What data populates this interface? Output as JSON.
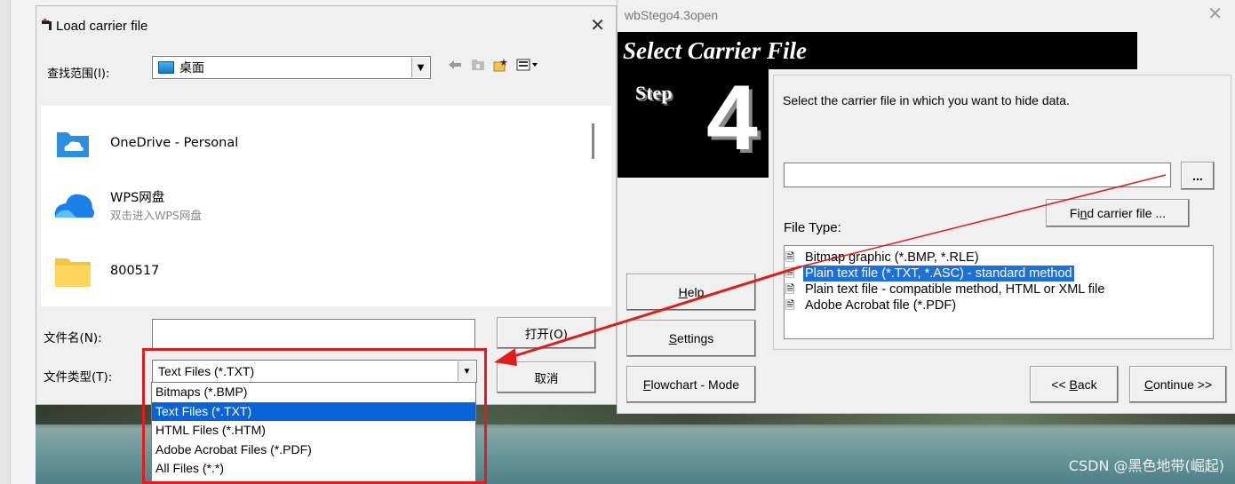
{
  "wbstego": {
    "title": "wbStego4.3open",
    "close_glyph": "✕",
    "banner_title": "Select Carrier File",
    "step_label": "Step",
    "step_number": "4",
    "description": "Select the carrier file in which you want to hide data.",
    "path_value": "",
    "browse_label": "...",
    "find_button": {
      "prefix": "Fi",
      "key": "n",
      "suffix": "d carrier file ..."
    },
    "file_type_label": "File Type:",
    "file_types": [
      {
        "label": "Bitmap graphic (*.BMP, *.RLE)",
        "selected": false
      },
      {
        "label": "Plain text file (*.TXT, *.ASC) - standard method",
        "selected": true
      },
      {
        "label": "Plain text file - compatible method, HTML or XML file",
        "selected": false
      },
      {
        "label": "Adobe Acrobat file (*.PDF)",
        "selected": false
      }
    ],
    "help_button": {
      "key": "H",
      "suffix": "elp"
    },
    "settings_button": {
      "key": "S",
      "suffix": "ettings"
    },
    "flowchart_button": {
      "key": "F",
      "suffix": "lowchart - Mode"
    },
    "back_button": {
      "prefix": "<< ",
      "key": "B",
      "suffix": "ack"
    },
    "continue_button": {
      "key": "C",
      "suffix": "ontinue >>"
    }
  },
  "dialog": {
    "title": "Load carrier file",
    "close_glyph": "✕",
    "look_in_label": "查找范围(I):",
    "look_in_value": "桌面",
    "files": [
      {
        "name": "OneDrive - Personal",
        "sub": "",
        "icon": "onedrive-icon"
      },
      {
        "name": "WPS网盘",
        "sub": "双击进入WPS网盘",
        "icon": "wps-cloud-icon"
      },
      {
        "name": "800517",
        "sub": "",
        "icon": "folder-icon"
      }
    ],
    "file_name_label": "文件名(N):",
    "file_name_value": "",
    "file_type_label": "文件类型(T):",
    "file_type_value": "Text Files (*.TXT)",
    "open_button": "打开(O)",
    "cancel_button": "取消",
    "file_type_options": [
      {
        "label": "Bitmaps (*.BMP)",
        "selected": false
      },
      {
        "label": "Text Files (*.TXT)",
        "selected": true
      },
      {
        "label": "HTML Files (*.HTM)",
        "selected": false
      },
      {
        "label": "Adobe Acrobat Files (*.PDF)",
        "selected": false
      },
      {
        "label": "All Files (*.*)",
        "selected": false
      }
    ]
  },
  "watermark": "CSDN @黑色地带(崛起)",
  "colors": {
    "annotation_red": "#e01c1c",
    "selection_blue": "#0a64d8"
  }
}
